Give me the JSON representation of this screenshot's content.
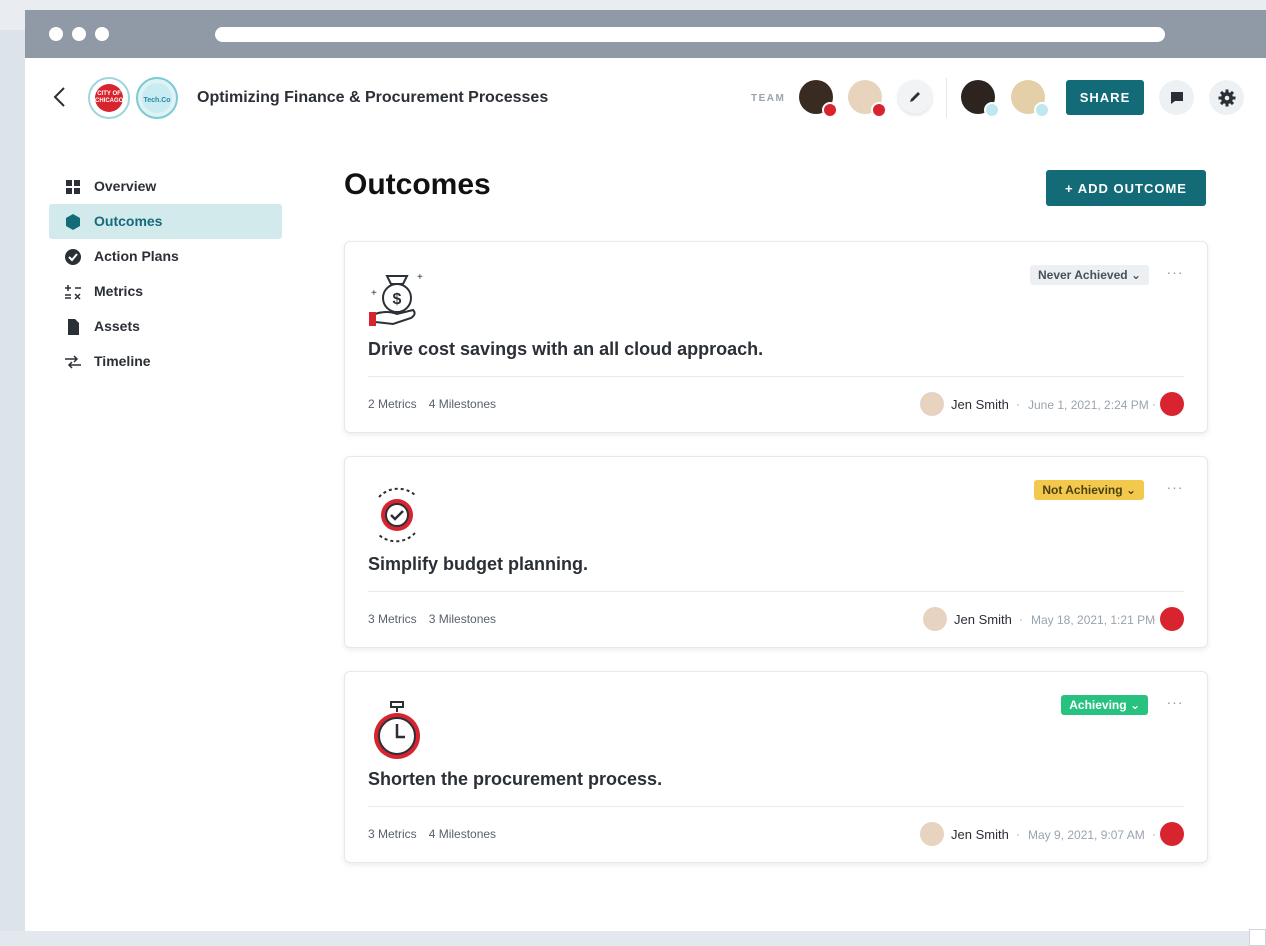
{
  "header": {
    "logos": [
      "CITY OF CHICAGO",
      "Tech.Co"
    ],
    "project_title": "Optimizing Finance & Procurement Processes",
    "team_label": "TEAM",
    "share_label": "SHARE"
  },
  "sidebar": {
    "items": [
      {
        "label": "Overview",
        "icon": "grid-icon"
      },
      {
        "label": "Outcomes",
        "icon": "hexagon-icon",
        "active": true
      },
      {
        "label": "Action Plans",
        "icon": "check-circle-icon"
      },
      {
        "label": "Metrics",
        "icon": "math-icon"
      },
      {
        "label": "Assets",
        "icon": "file-icon"
      },
      {
        "label": "Timeline",
        "icon": "timeline-icon"
      }
    ]
  },
  "main": {
    "title": "Outcomes",
    "add_label": "+ ADD OUTCOME",
    "outcomes": [
      {
        "title": "Drive cost savings with an all cloud approach.",
        "status": "Never Achieved",
        "metrics": "2 Metrics",
        "milestones": "4 Milestones",
        "owner": "Jen Smith",
        "date": "June 1, 2021, 2:24 PM",
        "illustration": "money-bag-icon"
      },
      {
        "title": "Simplify budget planning.",
        "status": "Not Achieving",
        "metrics": "3 Metrics",
        "milestones": "3 Milestones",
        "owner": "Jen Smith",
        "date": "May 18, 2021, 1:21 PM",
        "illustration": "gear-check-icon"
      },
      {
        "title": "Shorten the procurement process.",
        "status": "Achieving",
        "metrics": "3 Metrics",
        "milestones": "4 Milestones",
        "owner": "Jen Smith",
        "date": "May 9, 2021, 9:07 AM",
        "illustration": "stopwatch-icon"
      }
    ]
  },
  "colors": {
    "accent": "#146b78",
    "active_nav_bg": "#d3eaed",
    "status_never": "#edf0f3",
    "status_not": "#f2c94c",
    "status_achieving": "#27c27f",
    "brand_red": "#d8242f"
  }
}
